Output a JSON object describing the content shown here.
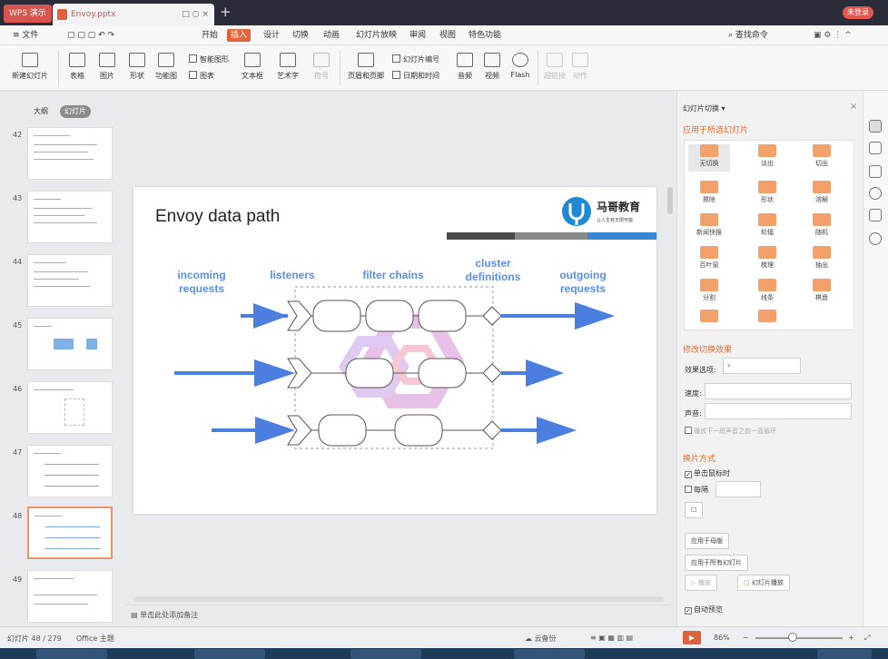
{
  "titlebar": {
    "app_label": "WPS 演示",
    "doc_tab": "Envoy.pptx",
    "tab_controls": "□ ○ ×",
    "plus": "+",
    "login": "未登录"
  },
  "menubar": {
    "file": "≡ 文件",
    "items": [
      "开始",
      "插入",
      "设计",
      "切换",
      "动画",
      "幻灯片放映",
      "审阅",
      "视图",
      "特色功能"
    ],
    "active_index": 1,
    "search": "查找命令"
  },
  "ribbon": {
    "new_slide": "新建幻灯片",
    "table": "表格",
    "picture": "图片",
    "shape": "形状",
    "icon_lib": "图标库",
    "function_chart": "功能图",
    "smart_graphic": "智能图形",
    "chart": "图表",
    "textbox": "文本框",
    "art_text": "艺术字",
    "symbol": "符号",
    "header_footer": "页眉和页脚",
    "slide_number": "幻灯片编号",
    "date_time": "日期和时间",
    "audio": "音频",
    "video": "视频",
    "flash": "Flash",
    "hyperlink": "超链接",
    "action": "动作"
  },
  "left_panel": {
    "tabs": [
      "大纲",
      "幻灯片"
    ],
    "thumbs": [
      "42",
      "43",
      "44",
      "45",
      "46",
      "47",
      "48",
      "49"
    ],
    "selected": "48"
  },
  "slide": {
    "title": "Envoy data path",
    "logo_text": "马哥教育",
    "logo_sub": "让人生有无限可能",
    "labels": {
      "incoming": "incoming\nrequests",
      "listeners": "listeners",
      "filter_chains": "filter chains",
      "cluster": "cluster\ndefinitions",
      "outgoing": "outgoing\nrequests"
    },
    "colors": {
      "arrow": "#4a7fe0",
      "label": "#5b8ee6",
      "node_stroke": "#555",
      "watermark1": "#d58fd6",
      "watermark2": "#f29ab2"
    }
  },
  "notes": {
    "placeholder": "单击此处添加备注"
  },
  "right_panel": {
    "title": "幻灯片切换 ▾",
    "apply_selected": "应用于所选幻灯片",
    "transitions": [
      "无切换",
      "淡出",
      "切出",
      "擦除",
      "形状",
      "溶解",
      "新闻快报",
      "轮辐",
      "随机",
      "百叶窗",
      "梳理",
      "抽出",
      "分割",
      "线条",
      "棋盘"
    ],
    "modify_heading": "修改切换效果",
    "effect_option_label": "效果选项:",
    "speed_label": "速度:",
    "sound_label": "声音:",
    "loop_label": "播放下一段声音之前一直循环",
    "advance_heading": "换片方式",
    "on_click": "单击鼠标时",
    "every": "每隔",
    "apply_master": "应用于母版",
    "apply_all": "应用于所有幻灯片",
    "play": "▷ 播放",
    "slideshow": "幻灯片播放",
    "autopreview": "自动预览"
  },
  "statusbar": {
    "slide_info": "幻灯片 48 / 279",
    "theme": "Office 主题",
    "backup": "云备份",
    "zoom": "86%"
  }
}
